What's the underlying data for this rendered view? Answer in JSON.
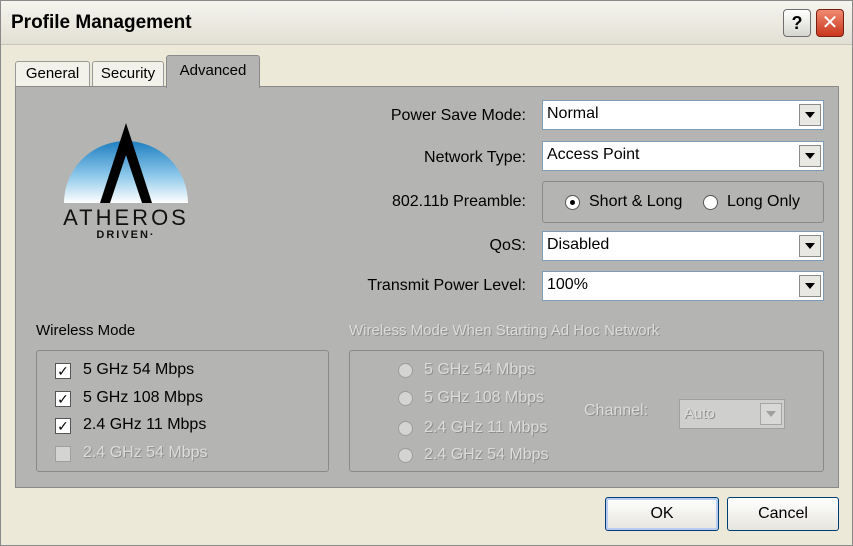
{
  "window": {
    "title": "Profile Management",
    "help_label": "?",
    "close_label": "✕"
  },
  "tabs": [
    {
      "label": "General",
      "active": false
    },
    {
      "label": "Security",
      "active": false
    },
    {
      "label": "Advanced",
      "active": true
    }
  ],
  "logo": {
    "brand": "ATHEROS",
    "tagline": "DRIVEN·"
  },
  "fields": {
    "power_save_mode": {
      "label": "Power Save Mode:",
      "value": "Normal"
    },
    "network_type": {
      "label": "Network Type:",
      "value": "Access Point"
    },
    "preamble": {
      "label": "802.11b Preamble:",
      "options": [
        {
          "label": "Short & Long",
          "selected": true
        },
        {
          "label": "Long Only",
          "selected": false
        }
      ]
    },
    "qos": {
      "label": "QoS:",
      "value": "Disabled"
    },
    "transmit_power": {
      "label": "Transmit Power Level:",
      "value": "100%"
    }
  },
  "wireless_mode": {
    "title": "Wireless Mode",
    "options": [
      {
        "label": "5 GHz 54 Mbps",
        "checked": true,
        "enabled": true
      },
      {
        "label": "5 GHz 108 Mbps",
        "checked": true,
        "enabled": true
      },
      {
        "label": "2.4 GHz 11 Mbps",
        "checked": true,
        "enabled": true
      },
      {
        "label": "2.4 GHz 54 Mbps",
        "checked": false,
        "enabled": false
      }
    ]
  },
  "adhoc_mode": {
    "title": "Wireless Mode When Starting Ad Hoc Network",
    "options": [
      {
        "label": "5 GHz 54 Mbps"
      },
      {
        "label": "5 GHz 108 Mbps"
      },
      {
        "label": "2.4 GHz 11 Mbps"
      },
      {
        "label": "2.4 GHz 54 Mbps"
      }
    ],
    "channel_label": "Channel:",
    "channel_value": "Auto"
  },
  "buttons": {
    "ok": "OK",
    "cancel": "Cancel"
  },
  "colors": {
    "panel": "#b4b4b2",
    "window": "#ece9d8",
    "close": "#c8361c"
  }
}
